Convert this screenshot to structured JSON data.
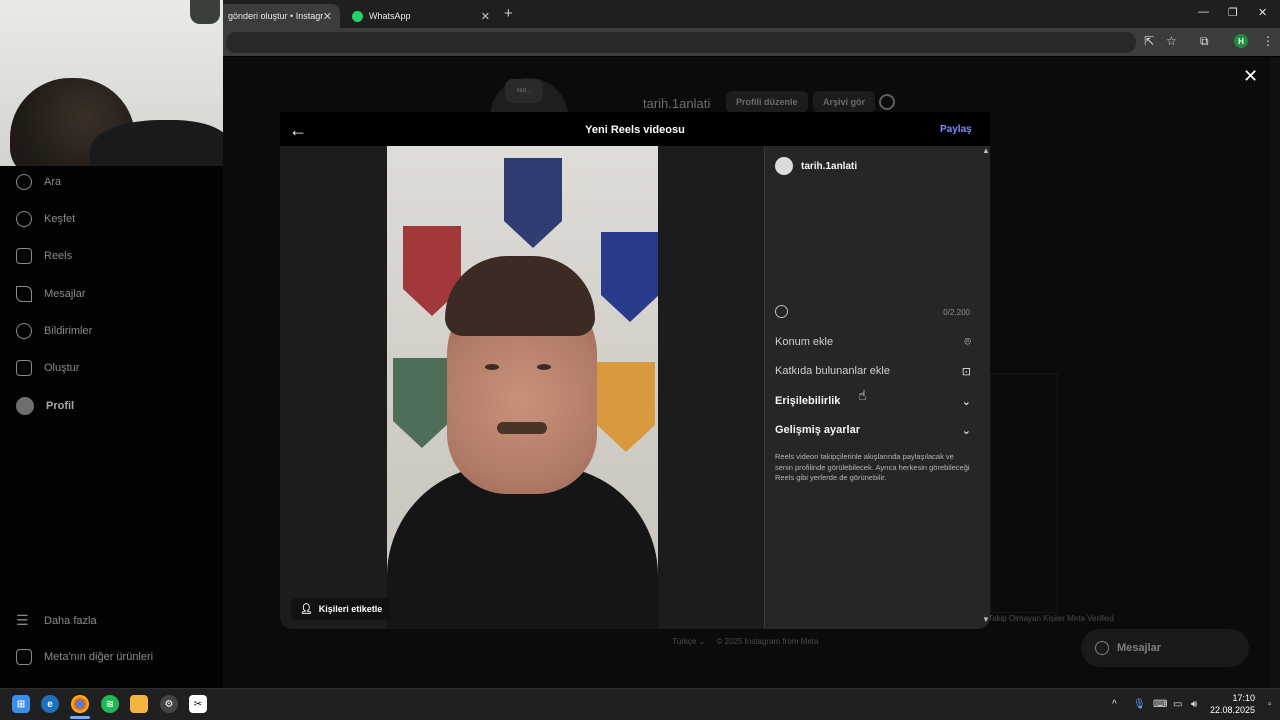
{
  "browser": {
    "tabs": [
      {
        "label": "gönderi oluştur • Instagram"
      },
      {
        "label": "WhatsApp"
      }
    ],
    "new_tab": "+",
    "window_controls": {
      "minimize": "—",
      "restore": "❐",
      "close": "✕"
    }
  },
  "instagram_bg": {
    "sidebar": [
      {
        "label": "Ara",
        "icon": "search-icon"
      },
      {
        "label": "Keşfet",
        "icon": "compass-icon"
      },
      {
        "label": "Reels",
        "icon": "reels-icon"
      },
      {
        "label": "Mesajlar",
        "icon": "send-icon"
      },
      {
        "label": "Bildirimler",
        "icon": "heart-icon"
      },
      {
        "label": "Oluştur",
        "icon": "plus-square-icon"
      },
      {
        "label": "Profil",
        "icon": "profile-icon"
      }
    ],
    "more": "Daha fazla",
    "meta_products": "Meta'nın diğer ürünleri",
    "profile": {
      "note": "Not...",
      "username": "tarih.1anlati",
      "edit_profile": "Profili düzenle",
      "view_archive": "Arşivi gör"
    },
    "footer_links": "Takip Olmayan Kişiler    Meta Verified",
    "footer": {
      "language": "Türkçe ⌄",
      "copyright": "© 2025 Instagram from Meta"
    },
    "messages_pill": "Mesajlar"
  },
  "modal": {
    "title": "Yeni Reels videosu",
    "share": "Paylaş",
    "tag_people": "Kişileri etiketle",
    "user": "tarih.1anlati",
    "char_count": "0/2.200",
    "rows": [
      {
        "label": "Konum ekle",
        "icon": "location-icon"
      },
      {
        "label": "Katkıda bulunanlar ekle",
        "icon": "collaborator-icon"
      },
      {
        "label": "Erişilebilirlik",
        "icon": "chevron-down-icon"
      },
      {
        "label": "Gelişmiş ayarlar",
        "icon": "chevron-down-icon"
      }
    ],
    "info": "Reels videon takipçilerinle akışlarında paylaşılacak ve senin profilinde görülebilecek. Ayrıca herkesin görebileceği Reels gibi yerlerde de görünebilir."
  },
  "taskbar": {
    "time": "17:10",
    "date": "22.08.2025"
  },
  "colors": {
    "accent_link": "#7f8cff",
    "modal_pane": "#262626",
    "background": "#000000"
  }
}
